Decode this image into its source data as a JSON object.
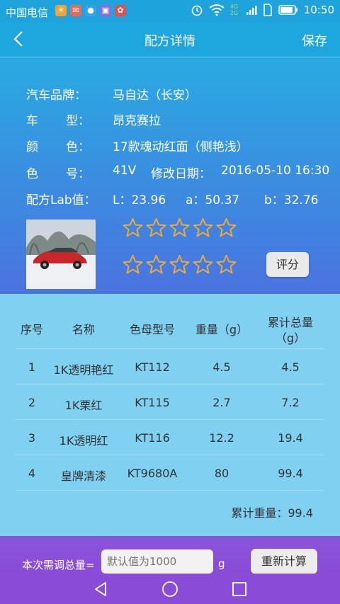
{
  "status_bar": {
    "carrier": "中国电信",
    "network": "4G 2G",
    "time": "10:50"
  },
  "header": {
    "title": "配方详情",
    "save_label": "保存"
  },
  "info": {
    "brand_label": "汽车品牌：",
    "brand_value": "马自达（长安）",
    "model_label_1": "车",
    "model_label_2": "型：",
    "model_value": "昂克赛拉",
    "color_label_1": "颜",
    "color_label_2": "色：",
    "color_value": "17款魂动红面（侧艳浅）",
    "colorno_label_1": "色",
    "colorno_label_2": "号：",
    "colorno_value": "41V",
    "date_label": "修改日期：",
    "date_value": "2016-05-10 16:30",
    "lab_label": "配方Lab值：",
    "l_value": "L：23.96",
    "a_value": "a：50.37",
    "b_value": "b：32.76",
    "star_rows": [
      0,
      0
    ],
    "rate_button": "评分"
  },
  "table": {
    "headers": [
      "序号",
      "名称",
      "色母型号",
      "重量（g）",
      "累计总量",
      "（g）"
    ],
    "rows": [
      [
        "1",
        "1K透明艳红",
        "KT112",
        "4.5",
        "4.5"
      ],
      [
        "2",
        "1K栗红",
        "KT115",
        "2.7",
        "7.2"
      ],
      [
        "3",
        "1K透明红",
        "KT116",
        "12.2",
        "19.4"
      ],
      [
        "4",
        "皇牌清漆",
        "KT9680A",
        "80",
        "99.4"
      ]
    ],
    "total_label": "累计重量：99.4"
  },
  "bottom": {
    "amount_label": "本次需调总量=",
    "amount_placeholder": "默认值为1000",
    "unit": "g",
    "recalc_button": "重新计算"
  },
  "colors": {
    "header": "#1ea7df",
    "table_bg": "#7fd0f1",
    "bottom": "#8a4cd6",
    "star": "#e8a93d"
  }
}
